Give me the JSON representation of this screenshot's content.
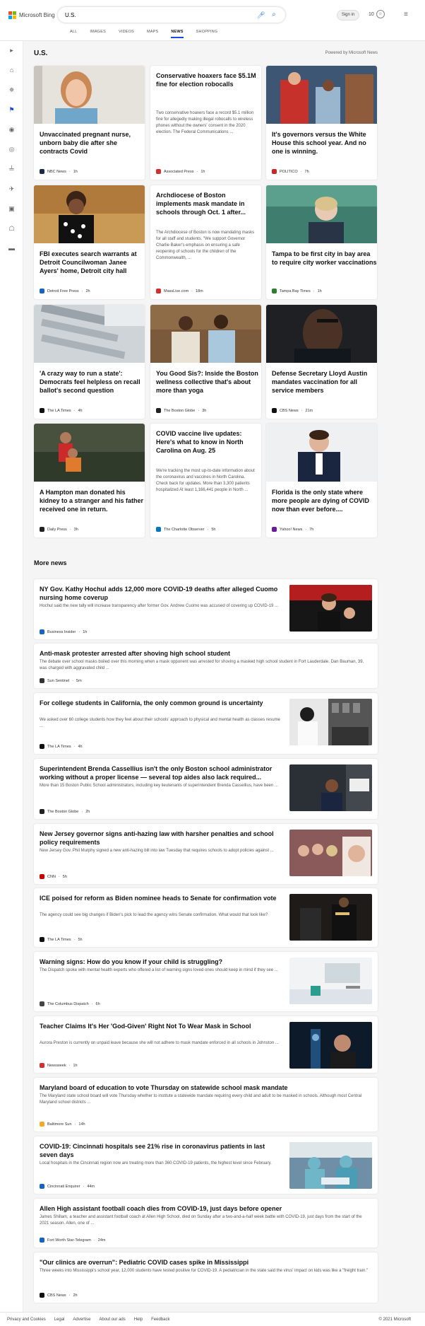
{
  "header": {
    "logo_text": "Microsoft Bing",
    "search_value": "U.S.",
    "signin_label": "Sign in",
    "rewards_count": "10"
  },
  "tabs": [
    "ALL",
    "IMAGES",
    "VIDEOS",
    "MAPS",
    "NEWS",
    "SHOPPING"
  ],
  "active_tab": "NEWS",
  "section": {
    "title": "U.S.",
    "powered": "Powered by Microsoft News"
  },
  "cards": [
    {
      "title": "Unvaccinated pregnant nurse, unborn baby die after she contracts Covid",
      "source": "NBC News",
      "time": "1h",
      "desc": "",
      "src_color": "#1b2a4a"
    },
    {
      "title": "Conservative hoaxers face $5.1M fine for election robocalls",
      "source": "Associated Press",
      "time": "1h",
      "desc": "Two conservative hoaxers face a record $5.1 million fine for allegedly making illegal robocalls to wireless phones without the owners' consent in the 2020 election. The Federal Communications ...",
      "src_color": "#d32f2f"
    },
    {
      "title": "It's governors versus the White House this school year. And no one is winning.",
      "source": "POLITICO",
      "time": "7h",
      "desc": "",
      "src_color": "#c62828"
    },
    {
      "title": "FBI executes search warrants at Detroit Councilwoman Janee Ayers' home, Detroit city hall",
      "source": "Detroit Free Press",
      "time": "2h",
      "desc": "",
      "src_color": "#1565c0"
    },
    {
      "title": "Archdiocese of Boston implements mask mandate in schools through Oct. 1 after...",
      "source": "MassLive.com",
      "time": "18m",
      "desc": "The Archdiocese of Boston is now mandating masks for all staff and students. \"We support Governor Charlie Baker's emphasis on ensuring a safe reopening of schools for the children of the Commonwealth, ...",
      "src_color": "#d32f2f"
    },
    {
      "title": "Tampa to be first city in bay area to require city worker vaccinations",
      "source": "Tampa Bay Times",
      "time": "1h",
      "desc": "",
      "src_color": "#2e7d32"
    },
    {
      "title": "'A crazy way to run a state': Democrats feel helpless on recall ballot's second question",
      "source": "The LA Times",
      "time": "4h",
      "desc": "",
      "src_color": "#111111"
    },
    {
      "title": "You Good Sis?: Inside the Boston wellness collective that's about more than yoga",
      "source": "The Boston Globe",
      "time": "3h",
      "desc": "",
      "src_color": "#222222"
    },
    {
      "title": "Defense Secretary Lloyd Austin mandates vaccination for all service members",
      "source": "CBS News",
      "time": "21m",
      "desc": "",
      "src_color": "#111111"
    },
    {
      "title": "A Hampton man donated his kidney to a stranger and his father received one in return.",
      "source": "Daily Press",
      "time": "3h",
      "desc": "",
      "src_color": "#222222"
    },
    {
      "title": "COVID vaccine live updates: Here's what to know in North Carolina on Aug. 25",
      "source": "The Charlotte Observer",
      "time": "5h",
      "desc": "We're tracking the most up-to-date information about the coronavirus and vaccines in North Carolina. Check back for updates. More than 3,300 patients hospitalized At least 1,166,441 people in North ...",
      "src_color": "#0277bd"
    },
    {
      "title": "Florida is the only state where more people are dying of COVID now than ever before....",
      "source": "Yahoo! News",
      "time": "7h",
      "desc": "",
      "src_color": "#6a1b9a"
    }
  ],
  "more_news": {
    "title": "More news",
    "items": [
      {
        "title": "NY Gov. Kathy Hochul adds 12,000 more COVID-19 deaths after alleged Cuomo nursing home coverup",
        "desc": "Hochul said the new tally will increase transparency after former Gov. Andrew Cuomo was accused of covering up COVID-19 ...",
        "source": "Business Insider",
        "time": "1h",
        "src_color": "#1565c0"
      },
      {
        "title": "Anti-mask protester arrested after shoving high school student",
        "desc": "The debate over school masks boiled over this morning when a mask opponent was arrested for shoving a masked high school student in Fort Lauderdale. Dan Bauman, 39, was charged with aggravated child ...",
        "source": "Sun Sentinel",
        "time": "5m",
        "src_color": "#333333"
      },
      {
        "title": "For college students in California, the only common ground is uncertainty",
        "desc": "We asked over 60 college students how they feel about their schools' approach to physical and mental health as classes resume ...",
        "source": "The LA Times",
        "time": "4h",
        "src_color": "#111111"
      },
      {
        "title": "Superintendent Brenda Cassellius isn't the only Boston school administrator working without a proper license — several top aides also lack required...",
        "desc": "More than 15 Boston Public School administrators, including key lieutenants of superintendent Brenda Cassellius, have been ...",
        "source": "The Boston Globe",
        "time": "2h",
        "src_color": "#222222"
      },
      {
        "title": "New Jersey governor signs anti-hazing law with harsher penalties and school policy requirements",
        "desc": "New Jersey Gov. Phil Murphy signed a new anti-hazing bill into law Tuesday that requires schools to adopt policies against ...",
        "source": "CNN",
        "time": "5h",
        "src_color": "#cc0000"
      },
      {
        "title": "ICE poised for reform as Biden nominee heads to Senate for confirmation vote",
        "desc": "The agency could see big changes if Biden's pick to lead the agency wins Senate confirmation. What would that look like?",
        "source": "The LA Times",
        "time": "5h",
        "src_color": "#111111"
      },
      {
        "title": "Warning signs: How do you know if your child is struggling?",
        "desc": "The Dispatch spoke with mental health experts who offered a list of warning signs loved ones should keep in mind if they see ...",
        "source": "The Columbus Dispatch",
        "time": "6h",
        "src_color": "#444444"
      },
      {
        "title": "Teacher Claims It's Her 'God-Given' Right Not To Wear Mask in School",
        "desc": "Aurora Preston is currently on unpaid leave because she will not adhere to mask mandate enforced in all schools in Johnston ...",
        "source": "Newsweek",
        "time": "1h",
        "src_color": "#d32f2f"
      },
      {
        "title": "Maryland board of education to vote Thursday on statewide school mask mandate",
        "desc": "The Maryland state school board will vote Thursday whether to institute a statewide mandate requiring every child and adult to be masked in schools. Although most Central Maryland school districts ...",
        "source": "Baltimore Sun",
        "time": "14h",
        "src_color": "#f9a825"
      },
      {
        "title": "COVID-19: Cincinnati hospitals see 21% rise in coronavirus patients in last seven days",
        "desc": "Local hospitals in the Cincinnati region now are treating more than 360 COVID-19 patients, the highest level since February.",
        "source": "Cincinnati Enquirer",
        "time": "44m",
        "src_color": "#1565c0"
      },
      {
        "title": "Allen High assistant football coach dies from COVID-19, just days before opener",
        "desc": "James Shillam, a teacher and assistant football coach at Allen High School, died on Sunday after a two-and-a-half week battle with COVID-19, just days from the start of the 2021 season. Allen, one of ...",
        "source": "Fort Worth Star-Telegram",
        "time": "24m",
        "src_color": "#1565c0"
      },
      {
        "title": "\"Our clinics are overrun\": Pediatric COVID cases spike in Mississippi",
        "desc": "Three weeks into Mississippi's school year, 12,000 students have tested positive for COVID-19. A pediatrician in the state said the virus' impact on kids was like a \"freight train.\"",
        "source": "CBS News",
        "time": "2h",
        "src_color": "#111111"
      }
    ]
  },
  "footer": {
    "links": [
      "Privacy and Cookies",
      "Legal",
      "Advertise",
      "About our ads",
      "Help",
      "Feedback"
    ],
    "copyright": "© 2021 Microsoft"
  }
}
